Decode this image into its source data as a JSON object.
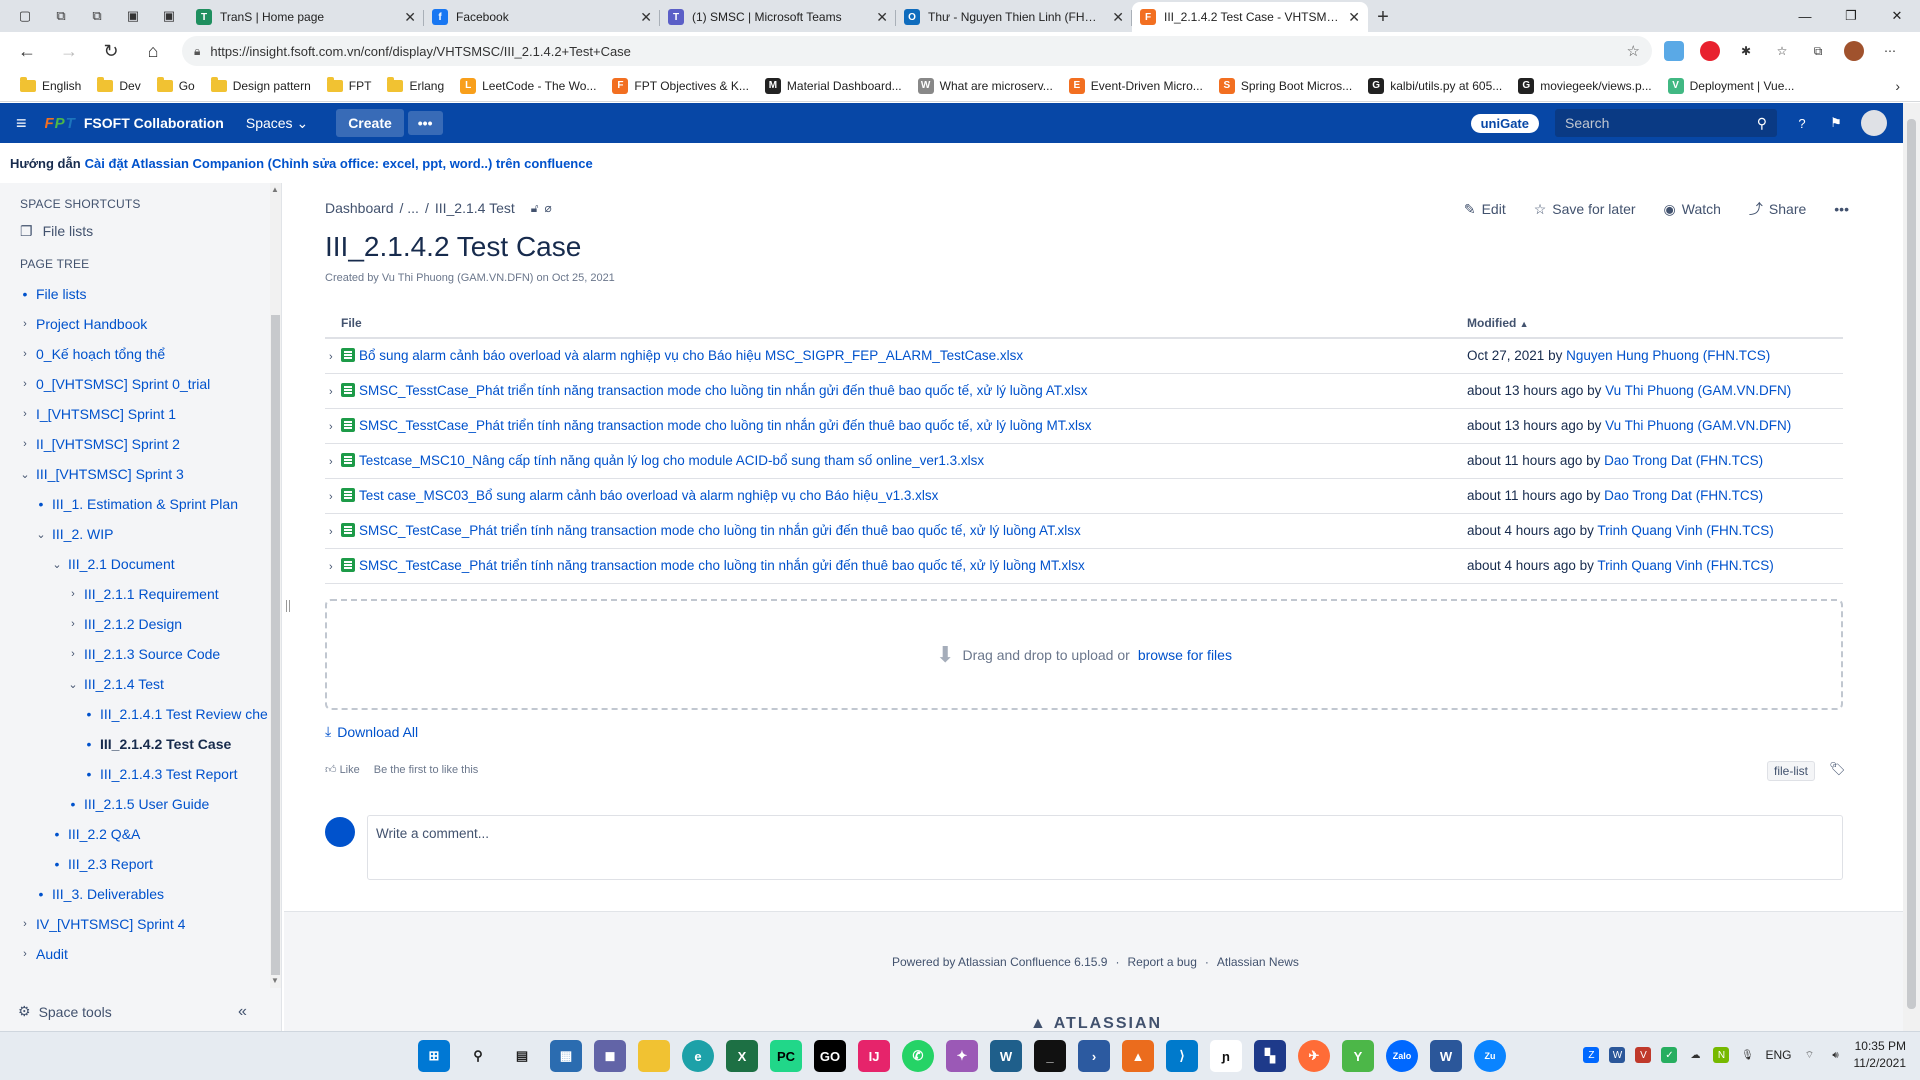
{
  "browser": {
    "tabs": [
      {
        "title": "TranS | Home page",
        "icon_color": "#1f8f5f",
        "icon": "T"
      },
      {
        "title": "Facebook",
        "icon_color": "#1877f2",
        "icon": "f"
      },
      {
        "title": "(1) SMSC | Microsoft Teams",
        "icon_color": "#5b5fc7",
        "icon": "T"
      },
      {
        "title": "Thư - Nguyen Thien Linh (FHN.T...",
        "icon_color": "#0f6cbd",
        "icon": "O"
      },
      {
        "title": "III_2.1.4.2 Test Case - VHTSMSC",
        "icon_color": "#f26f21",
        "icon": "F",
        "active": true
      }
    ],
    "url": "https://insight.fsoft.com.vn/conf/display/VHTSMSC/III_2.1.4.2+Test+Case",
    "bookmarks": [
      {
        "label": "English",
        "type": "folder"
      },
      {
        "label": "Dev",
        "type": "folder"
      },
      {
        "label": "Go",
        "type": "folder"
      },
      {
        "label": "Design pattern",
        "type": "folder"
      },
      {
        "label": "FPT",
        "type": "folder"
      },
      {
        "label": "Erlang",
        "type": "folder"
      },
      {
        "label": "LeetCode - The Wo...",
        "type": "site",
        "color": "#f89f1b",
        "icon": "L"
      },
      {
        "label": "FPT Objectives & K...",
        "type": "site",
        "color": "#f26f21",
        "icon": "F"
      },
      {
        "label": "Material Dashboard...",
        "type": "site",
        "color": "#222",
        "icon": "M"
      },
      {
        "label": "What are microserv...",
        "type": "site",
        "color": "#888",
        "icon": "W"
      },
      {
        "label": "Event-Driven Micro...",
        "type": "site",
        "color": "#f26f21",
        "icon": "E"
      },
      {
        "label": "Spring Boot Micros...",
        "type": "site",
        "color": "#f26f21",
        "icon": "S"
      },
      {
        "label": "kalbi/utils.py at 605...",
        "type": "site",
        "color": "#222",
        "icon": "G"
      },
      {
        "label": "moviegeek/views.p...",
        "type": "site",
        "color": "#222",
        "icon": "G"
      },
      {
        "label": "Deployment | Vue...",
        "type": "site",
        "color": "#41b883",
        "icon": "V"
      }
    ]
  },
  "header": {
    "logo_text": "FPT",
    "app_name": "FSOFT Collaboration",
    "spaces_label": "Spaces",
    "create_label": "Create",
    "more_label": "•••",
    "unigate_label": "uniGate",
    "search_placeholder": "Search"
  },
  "announcement": {
    "prefix": "Hướng dẫn",
    "link": "Cài đặt Atlassian Companion (Chỉnh sửa office: excel, ppt, word..) trên confluence"
  },
  "sidebar": {
    "shortcuts_heading": "SPACE SHORTCUTS",
    "shortcut_label": "File lists",
    "tree_heading": "PAGE TREE",
    "tree": [
      {
        "label": "File lists",
        "level": 0,
        "kind": "dot"
      },
      {
        "label": "Project Handbook",
        "level": 0,
        "kind": "closed"
      },
      {
        "label": "0_Kế hoạch tổng thể",
        "level": 0,
        "kind": "closed"
      },
      {
        "label": "0_[VHTSMSC] Sprint 0_trial",
        "level": 0,
        "kind": "closed"
      },
      {
        "label": "I_[VHTSMSC] Sprint 1",
        "level": 0,
        "kind": "closed"
      },
      {
        "label": "II_[VHTSMSC] Sprint 2",
        "level": 0,
        "kind": "closed"
      },
      {
        "label": "III_[VHTSMSC] Sprint 3",
        "level": 0,
        "kind": "open"
      },
      {
        "label": "III_1. Estimation & Sprint Plan",
        "level": 1,
        "kind": "dot"
      },
      {
        "label": "III_2. WIP",
        "level": 1,
        "kind": "open"
      },
      {
        "label": "III_2.1 Document",
        "level": 2,
        "kind": "open"
      },
      {
        "label": "III_2.1.1 Requirement",
        "level": 3,
        "kind": "closed"
      },
      {
        "label": "III_2.1.2 Design",
        "level": 3,
        "kind": "closed"
      },
      {
        "label": "III_2.1.3 Source Code",
        "level": 3,
        "kind": "closed"
      },
      {
        "label": "III_2.1.4 Test",
        "level": 3,
        "kind": "open"
      },
      {
        "label": "III_2.1.4.1 Test Review che",
        "level": 4,
        "kind": "dot"
      },
      {
        "label": "III_2.1.4.2 Test Case",
        "level": 4,
        "kind": "dot",
        "current": true
      },
      {
        "label": "III_2.1.4.3 Test Report",
        "level": 4,
        "kind": "dot"
      },
      {
        "label": "III_2.1.5 User Guide",
        "level": 3,
        "kind": "dot"
      },
      {
        "label": "III_2.2 Q&A",
        "level": 2,
        "kind": "dot"
      },
      {
        "label": "III_2.3 Report",
        "level": 2,
        "kind": "dot"
      },
      {
        "label": "III_3. Deliverables",
        "level": 1,
        "kind": "dot"
      },
      {
        "label": "IV_[VHTSMSC] Sprint 4",
        "level": 0,
        "kind": "closed"
      },
      {
        "label": "Audit",
        "level": 0,
        "kind": "closed"
      }
    ],
    "space_tools_label": "Space tools"
  },
  "page": {
    "breadcrumb": [
      "Dashboard",
      "/ ...",
      "/",
      "III_2.1.4 Test"
    ],
    "actions": {
      "edit": "Edit",
      "save": "Save for later",
      "watch": "Watch",
      "share": "Share",
      "more": "•••"
    },
    "title": "III_2.1.4.2 Test Case",
    "byline": "Created by Vu Thi Phuong (GAM.VN.DFN) on Oct 25, 2021",
    "table": {
      "col_file": "File",
      "col_modified": "Modified",
      "rows": [
        {
          "file": "Bổ sung alarm cảnh báo overload và alarm nghiệp vụ cho Báo hiệu MSC_SIGPR_FEP_ALARM_TestCase.xlsx",
          "when": "Oct 27, 2021",
          "by": "by",
          "user": "Nguyen Hung Phuong (FHN.TCS)"
        },
        {
          "file": "SMSC_TesstCase_Phát triển tính năng transaction mode cho luồng tin nhắn gửi đến thuê bao quốc tế, xử lý luồng AT.xlsx",
          "when": "about 13 hours ago",
          "by": "by",
          "user": "Vu Thi Phuong (GAM.VN.DFN)"
        },
        {
          "file": "SMSC_TesstCase_Phát triển tính năng transaction mode cho luồng tin nhắn gửi đến thuê bao quốc tế, xử lý luồng MT.xlsx",
          "when": "about 13 hours ago",
          "by": "by",
          "user": "Vu Thi Phuong (GAM.VN.DFN)"
        },
        {
          "file": "Testcase_MSC10_Nâng cấp tính năng quản lý log cho module ACID-bổ sung tham số online_ver1.3.xlsx",
          "when": "about 11 hours ago",
          "by": "by",
          "user": "Dao Trong Dat (FHN.TCS)"
        },
        {
          "file": "Test case_MSC03_Bổ sung alarm cảnh báo overload và alarm nghiệp vụ cho Báo hiệu_v1.3.xlsx",
          "when": "about 11 hours ago",
          "by": "by",
          "user": "Dao Trong Dat (FHN.TCS)"
        },
        {
          "file": "SMSC_TestCase_Phát triển tính năng transaction mode cho luồng tin nhắn gửi đến thuê bao quốc tế, xử lý luồng AT.xlsx",
          "when": "about 4 hours ago",
          "by": "by",
          "user": "Trinh Quang Vinh (FHN.TCS)"
        },
        {
          "file": "SMSC_TestCase_Phát triển tính năng transaction mode cho luồng tin nhắn gửi đến thuê bao quốc tế, xử lý luồng MT.xlsx",
          "when": "about 4 hours ago",
          "by": "by",
          "user": "Trinh Quang Vinh (FHN.TCS)"
        }
      ]
    },
    "dropzone_text": "Drag and drop to upload or",
    "dropzone_link": "browse for files",
    "download_all": "Download All",
    "like_label": "Like",
    "like_hint": "Be the first to like this",
    "label_tag": "file-list",
    "comment_placeholder": "Write a comment...",
    "footer": {
      "powered": "Powered by Atlassian Confluence 6.15.9",
      "sep": "·",
      "report": "Report a bug",
      "news": "Atlassian News"
    },
    "atlassian_logo": "ATLASSIAN"
  },
  "taskbar": {
    "lang": "ENG",
    "time": "10:35 PM",
    "date": "11/2/2021"
  }
}
